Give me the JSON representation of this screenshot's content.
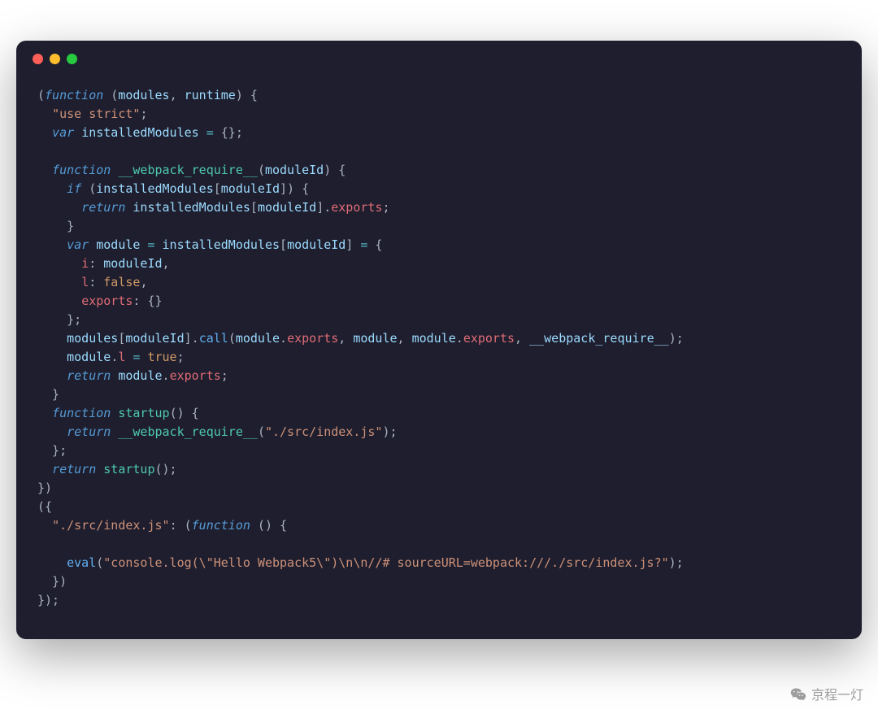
{
  "watermark": "京程一灯",
  "code": {
    "lines": [
      [
        {
          "t": "pun",
          "v": "("
        },
        {
          "t": "k",
          "v": "function"
        },
        {
          "t": "pun",
          "v": " ("
        },
        {
          "t": "prm",
          "v": "modules"
        },
        {
          "t": "pun",
          "v": ", "
        },
        {
          "t": "prm",
          "v": "runtime"
        },
        {
          "t": "pun",
          "v": ") {"
        }
      ],
      [
        {
          "t": "pun",
          "v": "  "
        },
        {
          "t": "str",
          "v": "\"use strict\""
        },
        {
          "t": "pun",
          "v": ";"
        }
      ],
      [
        {
          "t": "pun",
          "v": "  "
        },
        {
          "t": "k",
          "v": "var"
        },
        {
          "t": "pun",
          "v": " "
        },
        {
          "t": "prm",
          "v": "installedModules"
        },
        {
          "t": "pun",
          "v": " "
        },
        {
          "t": "op",
          "v": "="
        },
        {
          "t": "pun",
          "v": " {};"
        }
      ],
      [
        {
          "t": "pun",
          "v": ""
        }
      ],
      [
        {
          "t": "pun",
          "v": "  "
        },
        {
          "t": "k",
          "v": "function"
        },
        {
          "t": "pun",
          "v": " "
        },
        {
          "t": "fn",
          "v": "__webpack_require__"
        },
        {
          "t": "pun",
          "v": "("
        },
        {
          "t": "prm",
          "v": "moduleId"
        },
        {
          "t": "pun",
          "v": ") {"
        }
      ],
      [
        {
          "t": "pun",
          "v": "    "
        },
        {
          "t": "k",
          "v": "if"
        },
        {
          "t": "pun",
          "v": " ("
        },
        {
          "t": "prm",
          "v": "installedModules"
        },
        {
          "t": "pun",
          "v": "["
        },
        {
          "t": "prm",
          "v": "moduleId"
        },
        {
          "t": "pun",
          "v": "]) {"
        }
      ],
      [
        {
          "t": "pun",
          "v": "      "
        },
        {
          "t": "k",
          "v": "return"
        },
        {
          "t": "pun",
          "v": " "
        },
        {
          "t": "prm",
          "v": "installedModules"
        },
        {
          "t": "pun",
          "v": "["
        },
        {
          "t": "prm",
          "v": "moduleId"
        },
        {
          "t": "pun",
          "v": "]."
        },
        {
          "t": "prop",
          "v": "exports"
        },
        {
          "t": "pun",
          "v": ";"
        }
      ],
      [
        {
          "t": "pun",
          "v": "    }"
        }
      ],
      [
        {
          "t": "pun",
          "v": "    "
        },
        {
          "t": "k",
          "v": "var"
        },
        {
          "t": "pun",
          "v": " "
        },
        {
          "t": "prm",
          "v": "module"
        },
        {
          "t": "pun",
          "v": " "
        },
        {
          "t": "op",
          "v": "="
        },
        {
          "t": "pun",
          "v": " "
        },
        {
          "t": "prm",
          "v": "installedModules"
        },
        {
          "t": "pun",
          "v": "["
        },
        {
          "t": "prm",
          "v": "moduleId"
        },
        {
          "t": "pun",
          "v": "] "
        },
        {
          "t": "op",
          "v": "="
        },
        {
          "t": "pun",
          "v": " {"
        }
      ],
      [
        {
          "t": "pun",
          "v": "      "
        },
        {
          "t": "prop",
          "v": "i"
        },
        {
          "t": "pun",
          "v": ": "
        },
        {
          "t": "prm",
          "v": "moduleId"
        },
        {
          "t": "pun",
          "v": ","
        }
      ],
      [
        {
          "t": "pun",
          "v": "      "
        },
        {
          "t": "prop",
          "v": "l"
        },
        {
          "t": "pun",
          "v": ": "
        },
        {
          "t": "lit",
          "v": "false"
        },
        {
          "t": "pun",
          "v": ","
        }
      ],
      [
        {
          "t": "pun",
          "v": "      "
        },
        {
          "t": "prop",
          "v": "exports"
        },
        {
          "t": "pun",
          "v": ": {}"
        }
      ],
      [
        {
          "t": "pun",
          "v": "    };"
        }
      ],
      [
        {
          "t": "pun",
          "v": "    "
        },
        {
          "t": "prm",
          "v": "modules"
        },
        {
          "t": "pun",
          "v": "["
        },
        {
          "t": "prm",
          "v": "moduleId"
        },
        {
          "t": "pun",
          "v": "]."
        },
        {
          "t": "mth",
          "v": "call"
        },
        {
          "t": "pun",
          "v": "("
        },
        {
          "t": "prm",
          "v": "module"
        },
        {
          "t": "pun",
          "v": "."
        },
        {
          "t": "prop",
          "v": "exports"
        },
        {
          "t": "pun",
          "v": ", "
        },
        {
          "t": "prm",
          "v": "module"
        },
        {
          "t": "pun",
          "v": ", "
        },
        {
          "t": "prm",
          "v": "module"
        },
        {
          "t": "pun",
          "v": "."
        },
        {
          "t": "prop",
          "v": "exports"
        },
        {
          "t": "pun",
          "v": ", "
        },
        {
          "t": "prm",
          "v": "__webpack_require__"
        },
        {
          "t": "pun",
          "v": ");"
        }
      ],
      [
        {
          "t": "pun",
          "v": "    "
        },
        {
          "t": "prm",
          "v": "module"
        },
        {
          "t": "pun",
          "v": "."
        },
        {
          "t": "prop",
          "v": "l"
        },
        {
          "t": "pun",
          "v": " "
        },
        {
          "t": "op",
          "v": "="
        },
        {
          "t": "pun",
          "v": " "
        },
        {
          "t": "lit",
          "v": "true"
        },
        {
          "t": "pun",
          "v": ";"
        }
      ],
      [
        {
          "t": "pun",
          "v": "    "
        },
        {
          "t": "k",
          "v": "return"
        },
        {
          "t": "pun",
          "v": " "
        },
        {
          "t": "prm",
          "v": "module"
        },
        {
          "t": "pun",
          "v": "."
        },
        {
          "t": "prop",
          "v": "exports"
        },
        {
          "t": "pun",
          "v": ";"
        }
      ],
      [
        {
          "t": "pun",
          "v": "  }"
        }
      ],
      [
        {
          "t": "pun",
          "v": "  "
        },
        {
          "t": "k",
          "v": "function"
        },
        {
          "t": "pun",
          "v": " "
        },
        {
          "t": "fn",
          "v": "startup"
        },
        {
          "t": "pun",
          "v": "() {"
        }
      ],
      [
        {
          "t": "pun",
          "v": "    "
        },
        {
          "t": "k",
          "v": "return"
        },
        {
          "t": "pun",
          "v": " "
        },
        {
          "t": "fn",
          "v": "__webpack_require__"
        },
        {
          "t": "pun",
          "v": "("
        },
        {
          "t": "str",
          "v": "\"./src/index.js\""
        },
        {
          "t": "pun",
          "v": ");"
        }
      ],
      [
        {
          "t": "pun",
          "v": "  };"
        }
      ],
      [
        {
          "t": "pun",
          "v": "  "
        },
        {
          "t": "k",
          "v": "return"
        },
        {
          "t": "pun",
          "v": " "
        },
        {
          "t": "fn",
          "v": "startup"
        },
        {
          "t": "pun",
          "v": "();"
        }
      ],
      [
        {
          "t": "pun",
          "v": "})"
        }
      ],
      [
        {
          "t": "pun",
          "v": "({"
        }
      ],
      [
        {
          "t": "pun",
          "v": "  "
        },
        {
          "t": "str",
          "v": "\"./src/index.js\""
        },
        {
          "t": "pun",
          "v": ": ("
        },
        {
          "t": "k",
          "v": "function"
        },
        {
          "t": "pun",
          "v": " () {"
        }
      ],
      [
        {
          "t": "pun",
          "v": ""
        }
      ],
      [
        {
          "t": "pun",
          "v": "    "
        },
        {
          "t": "mth",
          "v": "eval"
        },
        {
          "t": "pun",
          "v": "("
        },
        {
          "t": "str",
          "v": "\"console.log(\\\"Hello Webpack5\\\")\\n\\n//# sourceURL=webpack:///./src/index.js?\""
        },
        {
          "t": "pun",
          "v": ");"
        }
      ],
      [
        {
          "t": "pun",
          "v": "  })"
        }
      ],
      [
        {
          "t": "pun",
          "v": "});"
        }
      ]
    ]
  }
}
